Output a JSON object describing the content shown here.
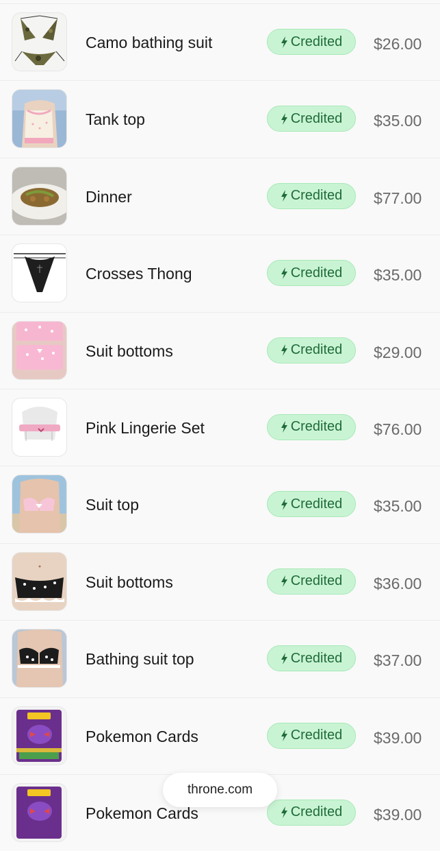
{
  "items": [
    {
      "name": "Camo bathing suit",
      "status": "Credited",
      "price": "$26.00",
      "icon": "bolt-icon"
    },
    {
      "name": "Tank top",
      "status": "Credited",
      "price": "$35.00",
      "icon": "bolt-icon"
    },
    {
      "name": "Dinner",
      "status": "Credited",
      "price": "$77.00",
      "icon": "bolt-icon"
    },
    {
      "name": "Crosses Thong",
      "status": "Credited",
      "price": "$35.00",
      "icon": "bolt-icon"
    },
    {
      "name": "Suit bottoms",
      "status": "Credited",
      "price": "$29.00",
      "icon": "bolt-icon"
    },
    {
      "name": "Pink Lingerie Set",
      "status": "Credited",
      "price": "$76.00",
      "icon": "bolt-icon"
    },
    {
      "name": "Suit top",
      "status": "Credited",
      "price": "$35.00",
      "icon": "bolt-icon"
    },
    {
      "name": "Suit bottoms",
      "status": "Credited",
      "price": "$36.00",
      "icon": "bolt-icon"
    },
    {
      "name": "Bathing suit top",
      "status": "Credited",
      "price": "$37.00",
      "icon": "bolt-icon"
    },
    {
      "name": "Pokemon Cards",
      "status": "Credited",
      "price": "$39.00",
      "icon": "bolt-icon"
    },
    {
      "name": "Pokemon Cards",
      "status": "Credited",
      "price": "$39.00",
      "icon": "bolt-icon"
    }
  ],
  "footer": {
    "url": "throne.com"
  },
  "colors": {
    "badge_bg": "#c9f4d4",
    "badge_text": "#1f6b39",
    "price_text": "#6a6a6a"
  }
}
